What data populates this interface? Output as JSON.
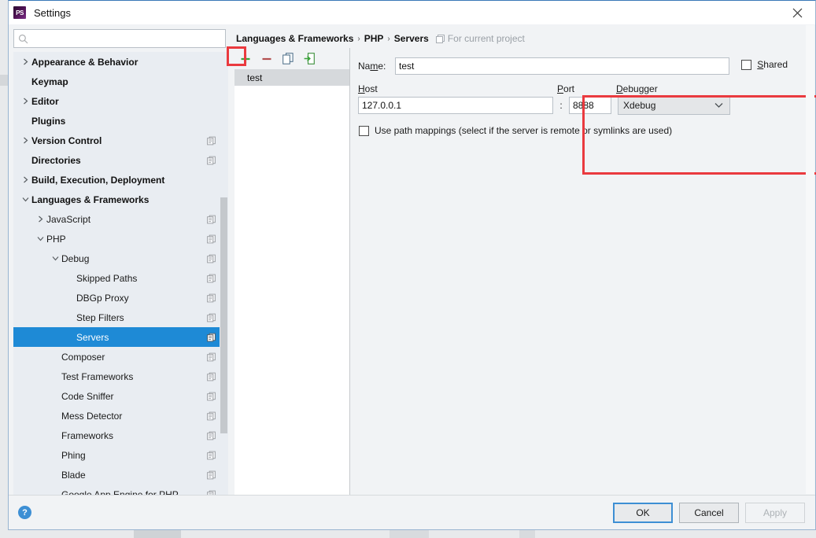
{
  "window": {
    "title": "Settings",
    "app_icon": "phpstorm-icon",
    "close_label": "×"
  },
  "search": {
    "value": "",
    "placeholder": "",
    "icon": "search-icon"
  },
  "sidebar": {
    "items": [
      {
        "label": "Appearance & Behavior",
        "indent": 0,
        "bold": true,
        "twisty": "collapsed",
        "copy": false,
        "selected": false
      },
      {
        "label": "Keymap",
        "indent": 0,
        "bold": true,
        "twisty": "none",
        "copy": false,
        "selected": false
      },
      {
        "label": "Editor",
        "indent": 0,
        "bold": true,
        "twisty": "collapsed",
        "copy": false,
        "selected": false
      },
      {
        "label": "Plugins",
        "indent": 0,
        "bold": true,
        "twisty": "none",
        "copy": false,
        "selected": false
      },
      {
        "label": "Version Control",
        "indent": 0,
        "bold": true,
        "twisty": "collapsed",
        "copy": true,
        "selected": false
      },
      {
        "label": "Directories",
        "indent": 0,
        "bold": true,
        "twisty": "none",
        "copy": true,
        "selected": false
      },
      {
        "label": "Build, Execution, Deployment",
        "indent": 0,
        "bold": true,
        "twisty": "collapsed",
        "copy": false,
        "selected": false
      },
      {
        "label": "Languages & Frameworks",
        "indent": 0,
        "bold": true,
        "twisty": "expanded",
        "copy": false,
        "selected": false
      },
      {
        "label": "JavaScript",
        "indent": 1,
        "bold": false,
        "twisty": "collapsed",
        "copy": true,
        "selected": false
      },
      {
        "label": "PHP",
        "indent": 1,
        "bold": false,
        "twisty": "expanded",
        "copy": true,
        "selected": false
      },
      {
        "label": "Debug",
        "indent": 2,
        "bold": false,
        "twisty": "expanded",
        "copy": true,
        "selected": false
      },
      {
        "label": "Skipped Paths",
        "indent": 3,
        "bold": false,
        "twisty": "none",
        "copy": true,
        "selected": false
      },
      {
        "label": "DBGp Proxy",
        "indent": 3,
        "bold": false,
        "twisty": "none",
        "copy": true,
        "selected": false
      },
      {
        "label": "Step Filters",
        "indent": 3,
        "bold": false,
        "twisty": "none",
        "copy": true,
        "selected": false
      },
      {
        "label": "Servers",
        "indent": 3,
        "bold": false,
        "twisty": "none",
        "copy": true,
        "selected": true
      },
      {
        "label": "Composer",
        "indent": 2,
        "bold": false,
        "twisty": "none",
        "copy": true,
        "selected": false
      },
      {
        "label": "Test Frameworks",
        "indent": 2,
        "bold": false,
        "twisty": "none",
        "copy": true,
        "selected": false
      },
      {
        "label": "Code Sniffer",
        "indent": 2,
        "bold": false,
        "twisty": "none",
        "copy": true,
        "selected": false
      },
      {
        "label": "Mess Detector",
        "indent": 2,
        "bold": false,
        "twisty": "none",
        "copy": true,
        "selected": false
      },
      {
        "label": "Frameworks",
        "indent": 2,
        "bold": false,
        "twisty": "none",
        "copy": true,
        "selected": false
      },
      {
        "label": "Phing",
        "indent": 2,
        "bold": false,
        "twisty": "none",
        "copy": true,
        "selected": false
      },
      {
        "label": "Blade",
        "indent": 2,
        "bold": false,
        "twisty": "none",
        "copy": true,
        "selected": false
      },
      {
        "label": "Google App Engine for PHP",
        "indent": 2,
        "bold": false,
        "twisty": "none",
        "copy": true,
        "selected": false
      }
    ]
  },
  "breadcrumb": {
    "parts": [
      "Languages & Frameworks",
      "PHP",
      "Servers"
    ],
    "separator": "›",
    "scope_label": "For current project",
    "scope_icon": "project-scope-icon"
  },
  "list_toolbar": {
    "buttons": [
      {
        "name": "add-server-button",
        "icon": "plus-icon",
        "label": "+",
        "highlighted": true
      },
      {
        "name": "remove-server-button",
        "icon": "minus-icon",
        "label": "−",
        "highlighted": false
      },
      {
        "name": "copy-server-button",
        "icon": "copy-icon",
        "label": "",
        "highlighted": false
      },
      {
        "name": "import-server-button",
        "icon": "import-icon",
        "label": "",
        "highlighted": false
      }
    ]
  },
  "server_list": {
    "items": [
      {
        "label": "test",
        "selected": true
      }
    ]
  },
  "form": {
    "name": {
      "label_pre": "Na",
      "label_mn": "m",
      "label_post": "e:",
      "value": "test"
    },
    "host": {
      "label_mn": "H",
      "label_post": "ost",
      "value": "127.0.0.1"
    },
    "separator": ":",
    "port": {
      "label_mn": "P",
      "label_post": "ort",
      "value": "8888"
    },
    "debugger": {
      "label_mn": "D",
      "label_post": "ebugger",
      "value": "Xdebug",
      "chevron": "chevron-down-icon"
    },
    "shared": {
      "label_mn": "S",
      "label_post": "hared",
      "checked": false
    },
    "path_mappings": {
      "label": "Use path mappings (select if the server is remote or symlinks are used)",
      "checked": false
    }
  },
  "footer": {
    "help_label": "?",
    "ok_label": "OK",
    "cancel_label": "Cancel",
    "apply_label": "Apply"
  },
  "colors": {
    "accent": "#1e8ad6",
    "annotation": "#ea3a3f",
    "toolbar_add": "#3aa33a",
    "dialog_bg": "#f1f3f5",
    "tree_bg": "#e9edf2"
  }
}
